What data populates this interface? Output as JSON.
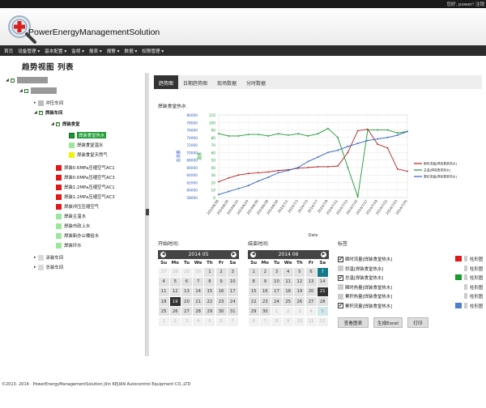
{
  "topbar": {
    "welcome": "您好, power! 注销"
  },
  "header": {
    "app_title": "PowerEnergyManagementSolution"
  },
  "menu": [
    {
      "label": "首页"
    },
    {
      "label": "设备管理 ▾"
    },
    {
      "label": "基本配置 ▾"
    },
    {
      "label": "监视 ▾"
    },
    {
      "label": "报表 ▾"
    },
    {
      "label": "报警 ▾"
    },
    {
      "label": "数据 ▾"
    },
    {
      "label": "权限管理 ▾"
    }
  ],
  "page": {
    "title": "趋势视图",
    "title2": "列表"
  },
  "tree": {
    "nodes": [
      {
        "label": "冲压车间"
      },
      {
        "label": "焊装车间"
      },
      {
        "label": "焊装食堂"
      },
      {
        "label": "焊装食堂热水"
      },
      {
        "label": "焊装食堂温水"
      },
      {
        "label": "焊装食堂天然气"
      },
      {
        "label": "焊装0.6MPa压缩空气AC1"
      },
      {
        "label": "焊装0.6MPa压缩空气AC3"
      },
      {
        "label": "焊装1.2MPa压缩空气AC1"
      },
      {
        "label": "焊装1.2MPa压缩空气AC3"
      },
      {
        "label": "焊装冲压压缩空气"
      },
      {
        "label": "焊装主温水"
      },
      {
        "label": "焊装市政上水"
      },
      {
        "label": "焊装新办公楼给水"
      },
      {
        "label": "焊装环水"
      },
      {
        "label": "涂装车间"
      },
      {
        "label": "总装车间"
      }
    ],
    "colors": {
      "red": "#e01818",
      "green": "#1a9a2e",
      "lightgreen": "#9be79b",
      "yellow": "#f2f20a",
      "gray": "#bdbdbd",
      "lightgray": "#d9d9d9"
    }
  },
  "tabs": [
    {
      "label": "趋势图"
    },
    {
      "label": "日期趋势图"
    },
    {
      "label": "现场数据"
    },
    {
      "label": "分时数据"
    }
  ],
  "chart_title": "焊装食堂热水",
  "chart_data": {
    "type": "line",
    "categories": [
      "2014/6/18",
      "2014/6/20",
      "2014/6/22",
      "2014/6/24",
      "2014/6/26",
      "2014/6/28",
      "2014/6/30",
      "2014/7/1",
      "2014/7/3",
      "2014/7/5",
      "2014/7/7",
      "2014/7/9",
      "2014/7/11",
      "2014/7/13",
      "2014/7/15",
      "2014/7/17",
      "2014/7/19",
      "2014/7/21",
      "2014/7/23",
      "2014/7/25"
    ],
    "xlabel": "Date",
    "y_left_label": "总流量",
    "y_left_ticks": [
      "80000",
      "78000",
      "76000",
      "74000",
      "72000",
      "70000",
      "68000",
      "66000",
      "64000",
      "62000",
      "60000",
      "58000"
    ],
    "y_mid_label": "温度",
    "y_mid_ticks": [
      "110",
      "100",
      "90",
      "80",
      "70",
      "60",
      "50",
      "40",
      "30",
      "20",
      "10",
      "0"
    ],
    "ylim_mid": [
      0,
      110
    ],
    "series": [
      {
        "name": "瞬时流量[焊装食堂热水]",
        "color": "#b22222",
        "values": [
          21,
          26,
          30,
          32,
          33,
          34,
          36,
          37,
          39,
          40,
          41,
          41,
          42,
          60,
          89,
          91,
          71,
          66,
          38,
          35
        ]
      },
      {
        "name": "总温[焊装食堂热水]",
        "color": "#1a9a2e",
        "values": [
          85,
          82,
          82,
          84,
          84,
          82,
          85,
          83,
          85,
          82,
          85,
          92,
          80,
          40,
          1,
          90,
          90,
          90,
          86,
          88
        ]
      },
      {
        "name": "累积流量[焊装食堂热水]",
        "color": "#3060c0",
        "values": [
          4,
          8,
          12,
          16,
          22,
          27,
          33,
          36,
          40,
          48,
          54,
          60,
          63,
          68,
          72,
          76,
          78,
          80,
          83,
          88
        ]
      }
    ]
  },
  "calendar_start": {
    "label": "开始时间:",
    "month": "2014 05",
    "dow": [
      "Su",
      "Mo",
      "Tu",
      "We",
      "Th",
      "Fr",
      "Sa"
    ],
    "days": [
      "27",
      "28",
      "29",
      "30",
      "1",
      "2",
      "3",
      "4",
      "5",
      "6",
      "7",
      "8",
      "9",
      "10",
      "11",
      "12",
      "13",
      "14",
      "15",
      "16",
      "17",
      "18",
      "19",
      "20",
      "21",
      "22",
      "23",
      "24",
      "25",
      "26",
      "27",
      "28",
      "29",
      "30",
      "31",
      "1",
      "2",
      "3",
      "4",
      "5",
      "6",
      "7"
    ]
  },
  "calendar_end": {
    "label": "结束时间:",
    "month": "2014 06",
    "dow": [
      "Su",
      "Mo",
      "Tu",
      "We",
      "Th",
      "Fr",
      "Sa"
    ],
    "days": [
      "1",
      "2",
      "3",
      "4",
      "5",
      "6",
      "7",
      "8",
      "9",
      "10",
      "11",
      "12",
      "13",
      "14",
      "15",
      "16",
      "17",
      "18",
      "19",
      "20",
      "21",
      "22",
      "23",
      "24",
      "25",
      "26",
      "27",
      "28",
      "29",
      "30",
      "1",
      "2",
      "3",
      "4",
      "5",
      "6",
      "7",
      "8",
      "9",
      "10",
      "11",
      "12"
    ]
  },
  "tags": {
    "label": "标签",
    "items": [
      {
        "label": "瞬时流量[焊装食堂热水]",
        "checked": true,
        "color": "#e01818"
      },
      {
        "label": "供温[焊装食堂热水]",
        "checked": false,
        "color": ""
      },
      {
        "label": "总温[焊装食堂热水]",
        "checked": true,
        "color": "#1a9a2e"
      },
      {
        "label": "瞬时热量[焊装食堂热水]",
        "checked": false,
        "color": ""
      },
      {
        "label": "累积热量[焊装食堂热水]",
        "checked": false,
        "color": ""
      },
      {
        "label": "累积流量[焊装食堂热水]",
        "checked": true,
        "color": "#4f7fd0"
      }
    ],
    "bar_label": "柱形图"
  },
  "buttons": {
    "view": "查看图表",
    "excel": "生成Excel",
    "print": "打印"
  },
  "footer": "©2013- 2014 · PowerEnergyManagementSolution Jilin KEJIAN Autocontrol Equipment CO.,LTD"
}
